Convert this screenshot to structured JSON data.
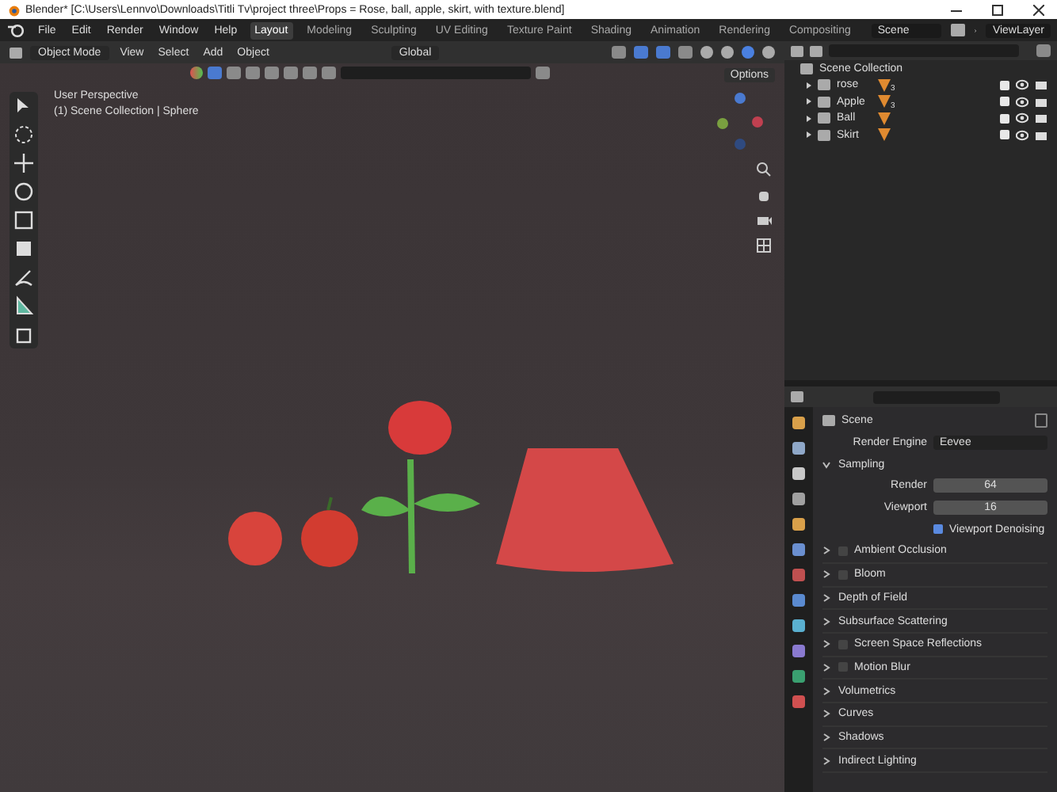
{
  "window": {
    "title": "Blender* [C:\\Users\\Lennvo\\Downloads\\Titli Tv\\project three\\Props = Rose, ball, apple, skirt, with texture.blend]"
  },
  "menu": [
    "File",
    "Edit",
    "Render",
    "Window",
    "Help"
  ],
  "workspaces": [
    {
      "label": "Layout",
      "selected": true
    },
    {
      "label": "Modeling",
      "selected": false
    },
    {
      "label": "Sculpting",
      "selected": false
    },
    {
      "label": "UV Editing",
      "selected": false
    },
    {
      "label": "Texture Paint",
      "selected": false
    },
    {
      "label": "Shading",
      "selected": false
    },
    {
      "label": "Animation",
      "selected": false
    },
    {
      "label": "Rendering",
      "selected": false
    },
    {
      "label": "Compositing",
      "selected": false
    }
  ],
  "scene": "Scene",
  "view_layer": "ViewLayer",
  "viewport": {
    "mode": "Object Mode",
    "menus": [
      "View",
      "Select",
      "Add",
      "Object"
    ],
    "orientation": "Global",
    "options": "Options",
    "overlay_text": [
      "User Perspective",
      "(1) Scene Collection | Sphere"
    ]
  },
  "outliner": {
    "root": "Scene Collection",
    "items": [
      {
        "label": "rose",
        "badge": "3",
        "checked": true
      },
      {
        "label": "Apple",
        "badge": "3",
        "checked": true
      },
      {
        "label": "Ball",
        "checked": true
      },
      {
        "label": "Skirt",
        "checked": true
      }
    ]
  },
  "properties": {
    "context": "Scene",
    "render_engine_label": "Render Engine",
    "render_engine": "Eevee",
    "sampling": {
      "label": "Sampling",
      "expanded": true,
      "fields": [
        {
          "label": "Render",
          "value": "64"
        },
        {
          "label": "Viewport",
          "value": "16"
        }
      ],
      "denoise": {
        "label": "Viewport Denoising",
        "checked": true
      }
    },
    "panels": [
      {
        "label": "Ambient Occlusion",
        "kind": "toggle",
        "checked": false
      },
      {
        "label": "Bloom",
        "kind": "toggle",
        "checked": false
      },
      {
        "label": "Depth of Field",
        "kind": "plain"
      },
      {
        "label": "Subsurface Scattering",
        "kind": "plain"
      },
      {
        "label": "Screen Space Reflections",
        "kind": "toggle",
        "checked": false
      },
      {
        "label": "Motion Blur",
        "kind": "toggle",
        "checked": false
      },
      {
        "label": "Volumetrics",
        "kind": "plain"
      },
      {
        "label": "Curves",
        "kind": "plain"
      },
      {
        "label": "Shadows",
        "kind": "plain"
      },
      {
        "label": "Indirect Lighting",
        "kind": "plain"
      }
    ]
  }
}
